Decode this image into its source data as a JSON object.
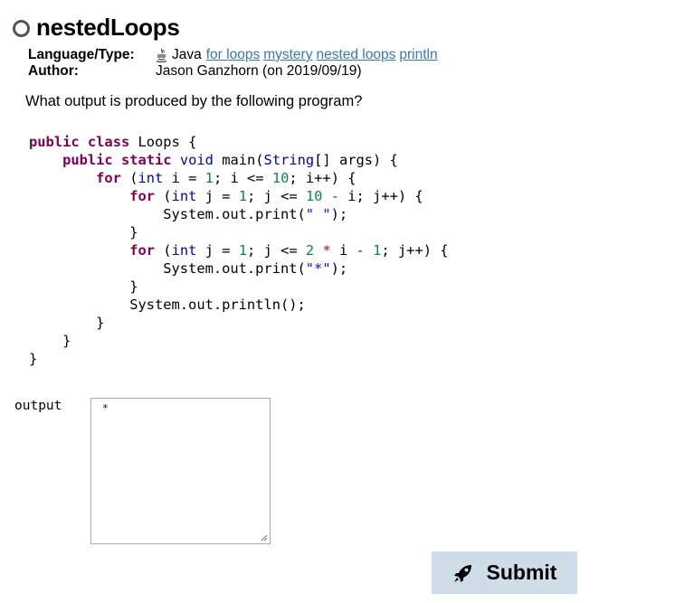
{
  "problem": {
    "title": "nestedLoops",
    "language_label": "Language/Type:",
    "language": "Java",
    "tags": [
      "for loops",
      "mystery",
      "nested loops",
      "println"
    ],
    "author_label": "Author:",
    "author": "Jason Ganzhorn (on 2019/09/19)"
  },
  "question": "What output is produced by the following program?",
  "code_lines": [
    "public class Loops {",
    "    public static void main(String[] args) {",
    "        for (int i = 1; i <= 10; i++) {",
    "            for (int j = 1; j <= 10 - i; j++) {",
    "                System.out.print(\" \");",
    "            }",
    "            for (int j = 1; j <= 2 * i - 1; j++) {",
    "                System.out.print(\"*\");",
    "            }",
    "            System.out.println();",
    "        }",
    "    }",
    "}"
  ],
  "output": {
    "label": "output",
    "value": "*"
  },
  "submit": {
    "label": "Submit",
    "icon": "rocket-icon"
  },
  "colors": {
    "keyword": "#7f0055",
    "type": "#0000c0",
    "number": "#098658",
    "string": "#2a00ff",
    "link": "#337ab7",
    "button_bg": "#cfdde9"
  }
}
